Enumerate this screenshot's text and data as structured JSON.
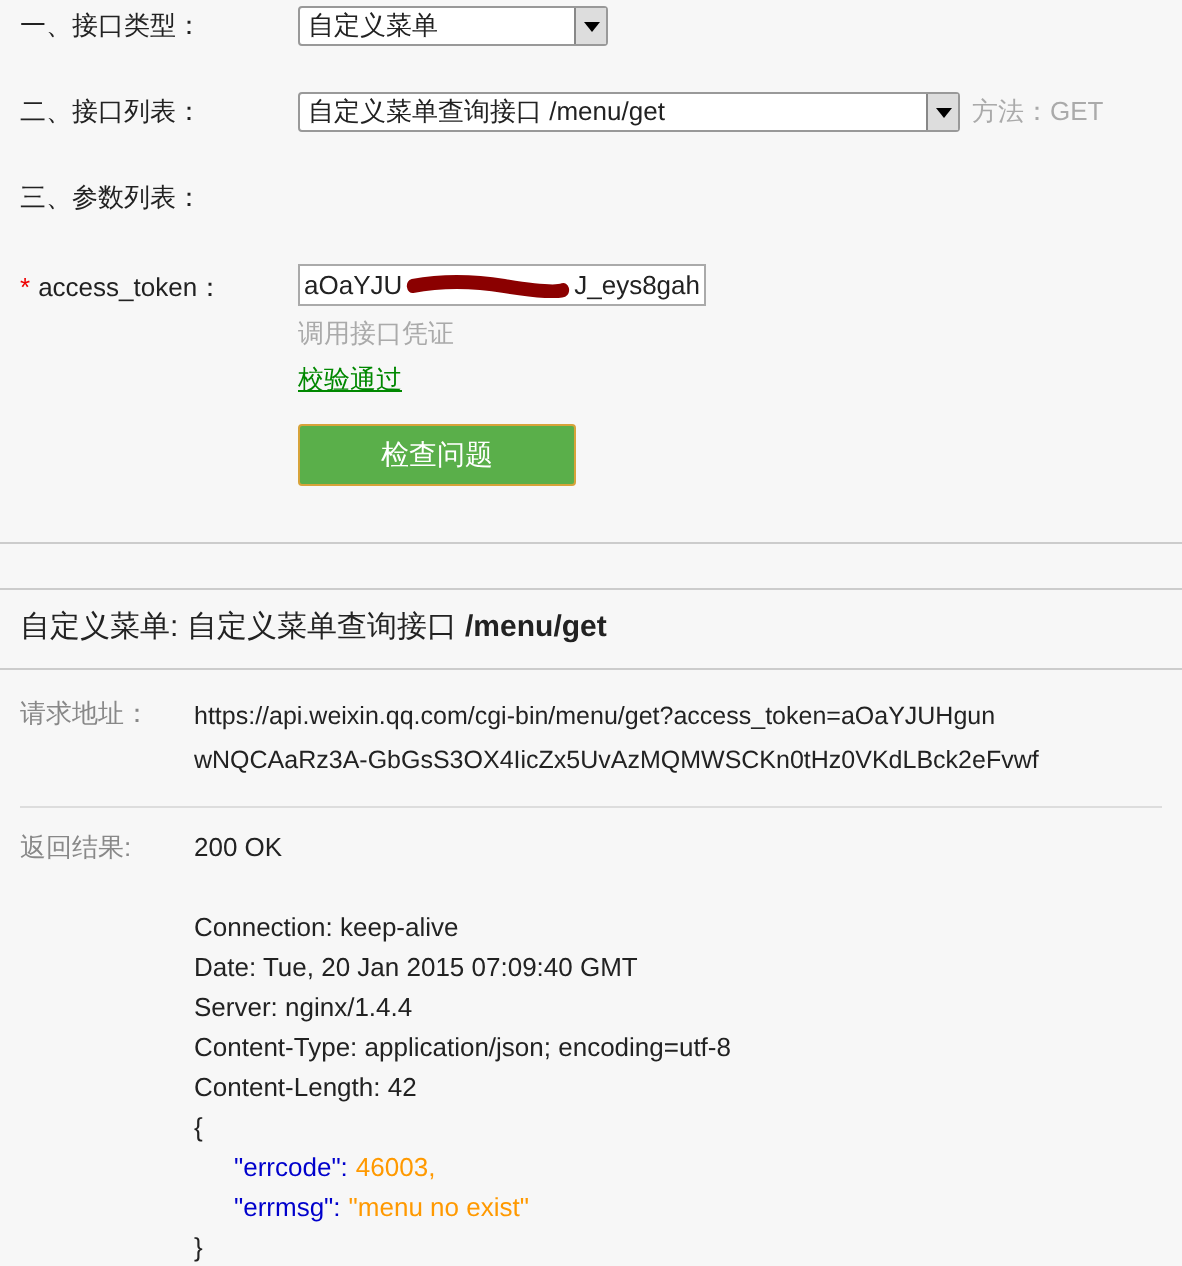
{
  "form": {
    "rows": [
      {
        "kind": "select",
        "label": "一、接口类型：",
        "value": "自定义菜单"
      },
      {
        "kind": "select",
        "label": "二、接口列表：",
        "value": "自定义菜单查询接口 /menu/get",
        "note": "方法：GET"
      },
      {
        "kind": "heading",
        "label": "三、参数列表："
      }
    ],
    "param": {
      "required_mark": "*",
      "label": "access_token：",
      "value_start": "aOaYJU",
      "value_end": "J_eys8gah",
      "hint": "调用接口凭证",
      "status": "校验通过",
      "valid": true
    },
    "button": "检查问题"
  },
  "result": {
    "title": "自定义菜单: 自定义菜单查询接口 **/menu/get**",
    "request_label": "请求地址：",
    "request_lines": [
      "https://api.weixin.qq.com/cgi-bin/menu/get?access_token=aOaYJUHgun",
      "wNQCAaRz3A-GbGsS3OX4IicZx5UvAzMQMWSCKn0tHz0VKdLBck2eFvwf"
    ],
    "response_label": "返回结果:",
    "status": "200 OK",
    "headers": [
      "Connection: keep-alive",
      "Date: Tue, 20 Jan 2015 07:09:40 GMT",
      "Server: nginx/1.4.4",
      "Content-Type: application/json; encoding=utf-8",
      "Content-Length: 42"
    ],
    "json_open": "{",
    "json_fields": [
      {
        "key": "\"errcode\":",
        "value": "46003,"
      },
      {
        "key": "\"errmsg\":",
        "value": "\"menu no exist\""
      }
    ],
    "json_close": "}"
  }
}
